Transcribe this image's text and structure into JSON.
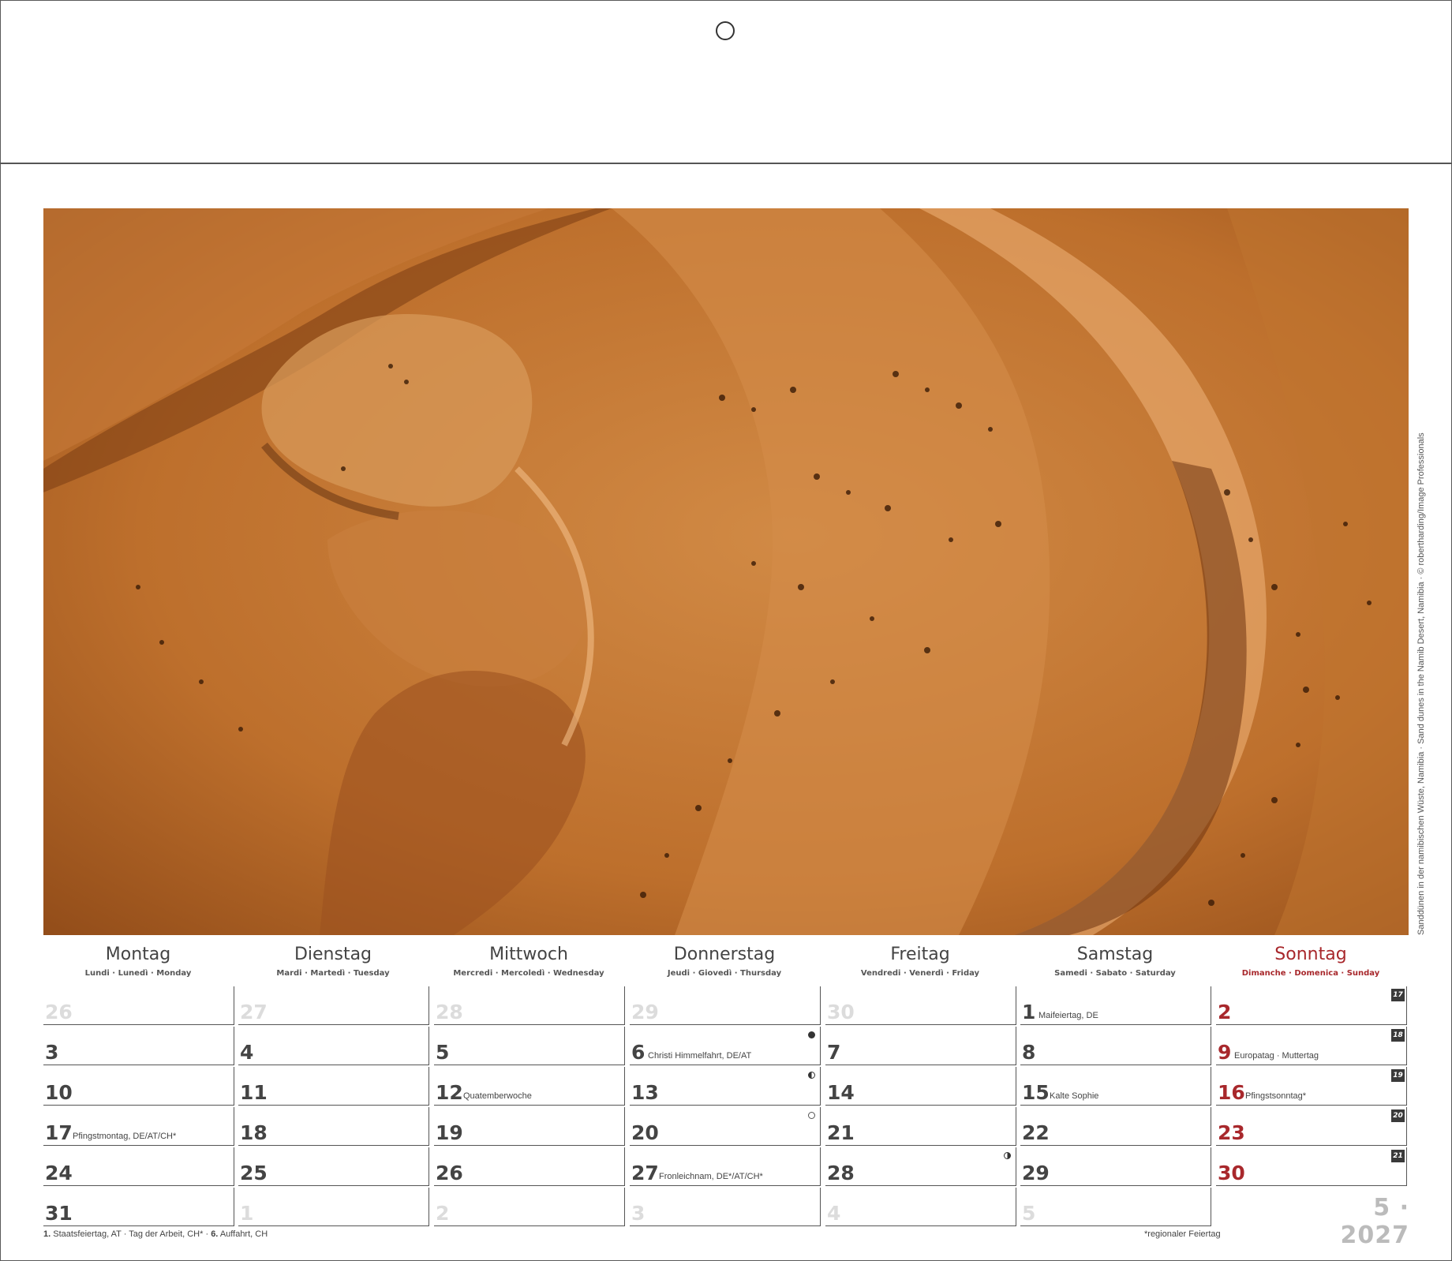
{
  "photo": {
    "subject": "sand-dunes-aerial",
    "credit": "Sanddünen in der namibischen Wüste, Namibia · Sand dunes in the Namib Desert, Namibia · © robertharding/Image Professionals"
  },
  "weekdays": [
    {
      "name": "Montag",
      "sub": "Lundi · Lunedì · Monday"
    },
    {
      "name": "Dienstag",
      "sub": "Mardi · Martedì · Tuesday"
    },
    {
      "name": "Mittwoch",
      "sub": "Mercredi · Mercoledì · Wednesday"
    },
    {
      "name": "Donnerstag",
      "sub": "Jeudi · Giovedì · Thursday"
    },
    {
      "name": "Freitag",
      "sub": "Vendredi · Venerdì · Friday"
    },
    {
      "name": "Samstag",
      "sub": "Samedi · Sabato · Saturday"
    },
    {
      "name": "Sonntag",
      "sub": "Dimanche · Domenica · Sunday"
    }
  ],
  "weeks": [
    {
      "kw": "17",
      "days": [
        {
          "n": "26",
          "faded": true
        },
        {
          "n": "27",
          "faded": true
        },
        {
          "n": "28",
          "faded": true
        },
        {
          "n": "29",
          "faded": true
        },
        {
          "n": "30",
          "faded": true
        },
        {
          "n": "1",
          "note": "Maifeiertag, DE"
        },
        {
          "n": "2",
          "red": true
        }
      ]
    },
    {
      "kw": "18",
      "days": [
        {
          "n": "3"
        },
        {
          "n": "4"
        },
        {
          "n": "5"
        },
        {
          "n": "6",
          "note": "Christi Himmelfahrt, DE/AT",
          "moon": "full"
        },
        {
          "n": "7"
        },
        {
          "n": "8"
        },
        {
          "n": "9",
          "red": true,
          "note": "Europatag  ·  Muttertag"
        }
      ]
    },
    {
      "kw": "19",
      "days": [
        {
          "n": "10"
        },
        {
          "n": "11"
        },
        {
          "n": "12",
          "note": "Quatemberwoche"
        },
        {
          "n": "13",
          "moon": "half"
        },
        {
          "n": "14"
        },
        {
          "n": "15",
          "note": "Kalte Sophie"
        },
        {
          "n": "16",
          "red": true,
          "note": "Pfingstsonntag*"
        }
      ]
    },
    {
      "kw": "20",
      "days": [
        {
          "n": "17",
          "note": "Pfingstmontag, DE/AT/CH*"
        },
        {
          "n": "18"
        },
        {
          "n": "19"
        },
        {
          "n": "20",
          "moon": "new"
        },
        {
          "n": "21"
        },
        {
          "n": "22"
        },
        {
          "n": "23",
          "red": true
        }
      ]
    },
    {
      "kw": "21",
      "days": [
        {
          "n": "24"
        },
        {
          "n": "25"
        },
        {
          "n": "26"
        },
        {
          "n": "27",
          "note": "Fronleichnam, DE*/AT/CH*"
        },
        {
          "n": "28",
          "moon": "half2"
        },
        {
          "n": "29"
        },
        {
          "n": "30",
          "red": true
        }
      ]
    },
    {
      "kw": "",
      "days": [
        {
          "n": "31"
        },
        {
          "n": "1",
          "faded": true
        },
        {
          "n": "2",
          "faded": true
        },
        {
          "n": "3",
          "faded": true
        },
        {
          "n": "4",
          "faded": true
        },
        {
          "n": "5",
          "faded": true
        }
      ]
    }
  ],
  "month_label": "5 · 2027",
  "footer": {
    "left_num1": "1.",
    "left_text1": "Staatsfeiertag, AT  ·  Tag der Arbeit, CH*  ·  ",
    "left_num2": "6.",
    "left_text2": "Auffahrt, CH",
    "right": "*regionaler Feiertag"
  }
}
